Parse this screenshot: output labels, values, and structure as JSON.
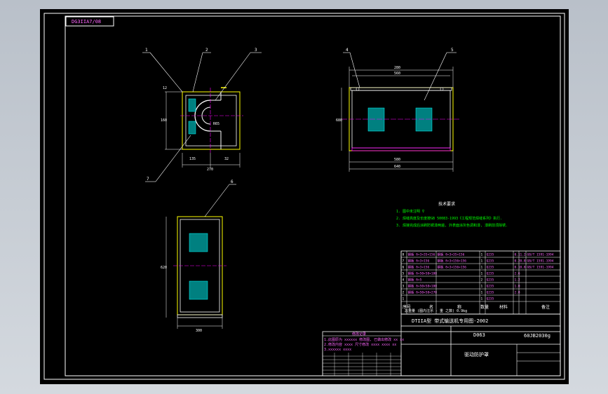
{
  "drawing": {
    "tag_label": "DG3IIA7/08",
    "title_main": "DTIIA型 带式输送机专用图-2002",
    "drawing_no": "D063",
    "part_code": "60JB2030g",
    "part_name": "驱动防护罩",
    "scale_row": "总重量 (图内注示 - 重 之数) 0.9kg",
    "table_head": [
      "序号",
      "名",
      "称",
      "数量",
      "材料",
      "备注"
    ],
    "notes_title": "技术要求",
    "notes": [
      "1. 图中未注明 ∇",
      "2. 焊缝高度及长度按GB 50083-1993《工程规范焊缝系列》执行.",
      "3. 焊接完成后涂刷防锈漆两遍, 外表面涂灰色调和漆, 漆刷前须除锈."
    ],
    "parts_rows": [
      [
        "8",
        "钢板 δ=3×35×156",
        "钢板 δ=3×35×156",
        "1",
        "Q235",
        "0.1",
        "1.2",
        "GB/T 1591-1994"
      ],
      [
        "7",
        "钢板 δ=3×156",
        "钢板 δ=3×156×156",
        "1",
        "Q235",
        "0.2",
        "0.8",
        "GB/T 1591-1994"
      ],
      [
        "6",
        "钢板 δ=3×156",
        "钢板 δ=3×156×156",
        "1",
        "Q235",
        "0.1",
        "0.8",
        "GB/T 1591-1994"
      ],
      [
        "5",
        "钢板 δ=50×58×180",
        "",
        "1",
        "Q235",
        "2.6",
        "",
        ""
      ],
      [
        "4",
        "钢板 δ=5",
        "",
        "2",
        "Q235",
        "1.2",
        "",
        ""
      ],
      [
        "3",
        "钢板 δ=50×58×180",
        "",
        "1",
        "Q235",
        "1.0",
        "",
        ""
      ],
      [
        "2",
        "钢板 δ=50×58×270",
        "",
        "1",
        "Q235",
        "2.8",
        "",
        ""
      ],
      [
        "1",
        "",
        "",
        "1",
        "Q235",
        "",
        "",
        ""
      ]
    ],
    "callouts_view1": [
      "1",
      "2",
      "3",
      "7"
    ],
    "callouts_view2": [
      "4",
      "5"
    ],
    "callouts_view3": [
      "6"
    ],
    "dims_view1": [
      "12",
      "R65",
      "160",
      "135",
      "270",
      "32"
    ],
    "dims_view2": [
      "280",
      "560",
      "580",
      "640",
      "680"
    ],
    "dims_view3": [
      "300",
      "620"
    ],
    "rev_block_title": "修改记录",
    "rev_rows": [
      "1.此图原为 xxxxxx 修改图, 已做出修改 xx xx",
      "2.修改内容 xxxx 尺寸修改 xxxx xxxx xx",
      "3.xxxxxx xxxx"
    ]
  }
}
